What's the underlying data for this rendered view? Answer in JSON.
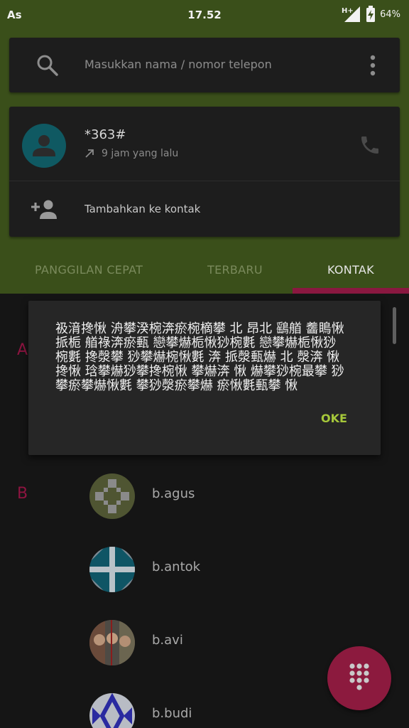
{
  "status": {
    "carrier": "As",
    "time": "17.52",
    "network": "H+",
    "battery": "64%"
  },
  "search": {
    "placeholder": "Masukkan nama / nomor telepon",
    "icon": "search-icon",
    "more_icon": "more-vert-icon"
  },
  "recent": {
    "number": "*363#",
    "time": "9 jam yang lalu",
    "call_icon": "phone-icon"
  },
  "add_contact": {
    "label": "Tambahkan ke kontak",
    "icon": "person-add-icon"
  },
  "tabs": [
    {
      "label": "PANGGILAN CEPAT"
    },
    {
      "label": "TERBARU"
    },
    {
      "label": "KONTAK",
      "active": true
    }
  ],
  "sections": [
    "A",
    "B"
  ],
  "contacts": [
    {
      "name": "b.agus"
    },
    {
      "name": "b.antok"
    },
    {
      "name": "b.avi"
    },
    {
      "name": "b.budi"
    }
  ],
  "dialog": {
    "message": "衱湇搀愀 洀攀湀椀渀瘀椀樀攀 北 昂北 鷂艏 齹瞗愀挀栀 艏祿渀瘀甀 戀攀爀栀愀猀椀氀 戀攀爀栀愀猀椀氀 搀漀攀 猀攀爀椀愀氀 渀 挀漀甀爀 北 漀渀 愀搀愀 琀攀爀猀攀搀椀愀 攀爀渀 愀 爀攀猀椀最攀 猀攀瘀攀爀愀氀 攀猀漀瘀攀爀 瘀愀氀甀攀 愀",
    "ok": "OKE"
  },
  "colors": {
    "header_green": "#3a4f1a",
    "accent": "#8a1840",
    "dialog_button": "#a6c83a"
  },
  "fab_icon": "dialpad-icon"
}
